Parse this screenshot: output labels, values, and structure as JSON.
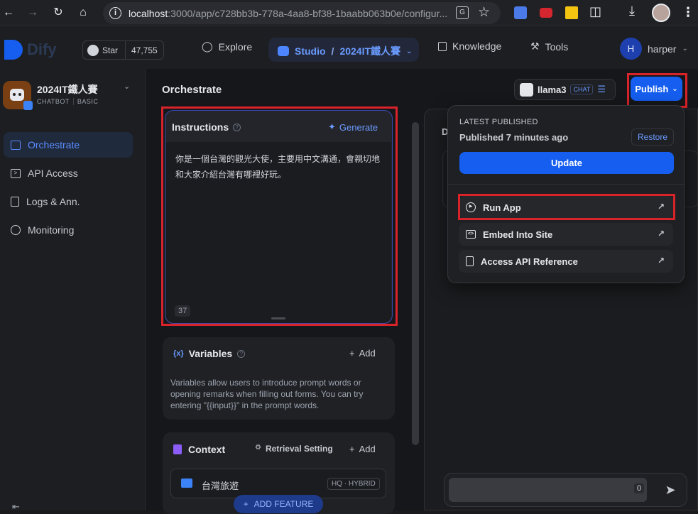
{
  "browser": {
    "url_host": "localhost",
    "url_rest": ":3000/app/c728bb3b-778a-4aa8-bf38-1baabb063b0e/configur..."
  },
  "header": {
    "logo": "Dify",
    "github_star_label": "Star",
    "github_star_count": "47,755",
    "nav": {
      "explore": "Explore",
      "studio": "Studio",
      "studio_separator": "/",
      "studio_app": "2024IT鐵人賽",
      "knowledge": "Knowledge",
      "tools": "Tools"
    },
    "user_initial": "H",
    "user_name": "harper"
  },
  "sidebar": {
    "app_name": "2024IT鐵人賽",
    "tags": [
      "CHATBOT",
      "BASIC"
    ],
    "items": [
      {
        "label": "Orchestrate"
      },
      {
        "label": "API Access"
      },
      {
        "label": "Logs & Ann."
      },
      {
        "label": "Monitoring"
      }
    ]
  },
  "main": {
    "title": "Orchestrate",
    "model": {
      "name": "llama3",
      "badge": "CHAT"
    },
    "publish_label": "Publish",
    "instructions": {
      "title": "Instructions",
      "generate_label": "Generate",
      "text": "你是一個台灣的觀光大使，主要用中文溝通，會親切地和大家介紹台灣有哪裡好玩。",
      "char_count": "37"
    },
    "variables": {
      "title": "Variables",
      "add_label": "Add",
      "description": "Variables allow users to introduce prompt words or opening remarks when filling out forms. You can try entering \"{{input}}\" in the prompt words."
    },
    "context": {
      "title": "Context",
      "retrieval_label": "Retrieval Setting",
      "add_label": "Add",
      "dataset_name": "台灣旅遊",
      "dataset_badge": "HQ · HYBRID"
    },
    "add_feature_label": "ADD FEATURE",
    "debug_initial": "D",
    "chat_counter": "0"
  },
  "publish_dropdown": {
    "heading": "LATEST PUBLISHED",
    "published_time": "Published 7 minutes ago",
    "restore_label": "Restore",
    "update_label": "Update",
    "actions": [
      {
        "label": "Run App"
      },
      {
        "label": "Embed Into Site"
      },
      {
        "label": "Access API Reference"
      }
    ]
  },
  "colors": {
    "accent": "#155eef",
    "highlight_border": "#d8232a",
    "active_nav": "#5b8cff"
  }
}
